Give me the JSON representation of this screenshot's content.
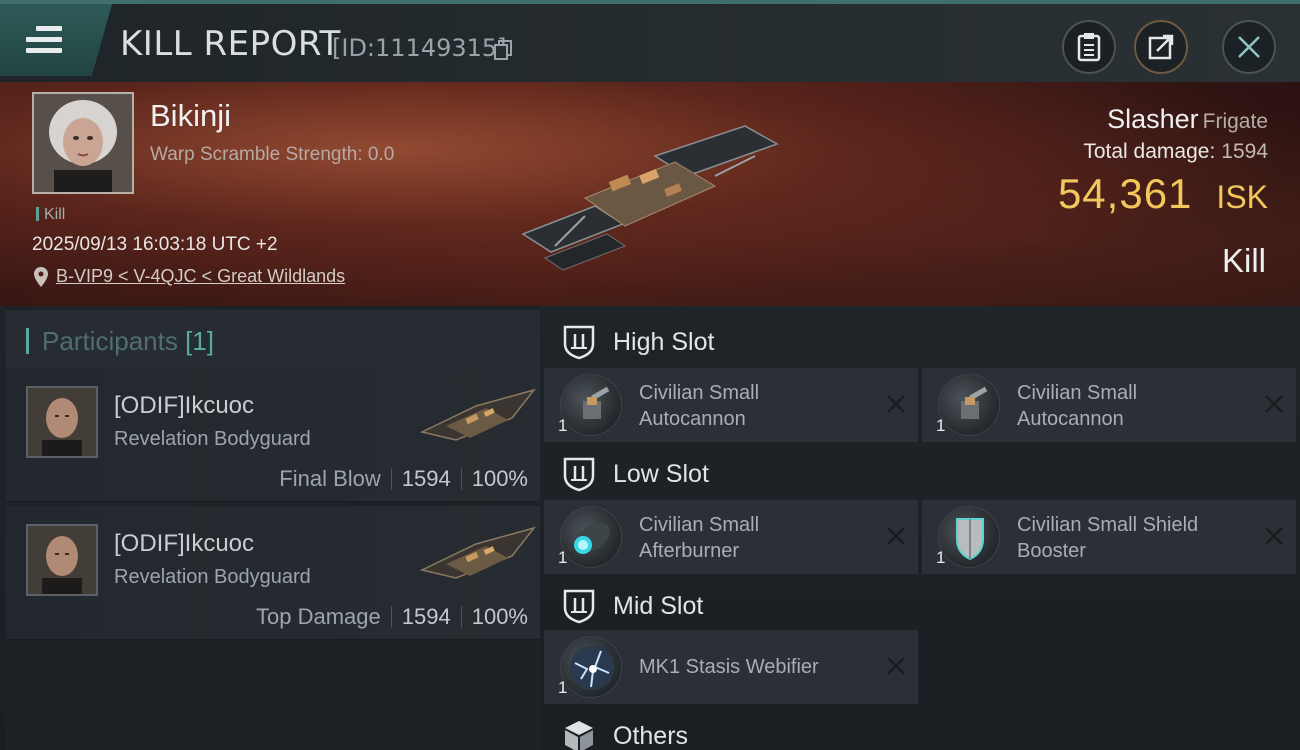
{
  "header": {
    "title": "KILL REPORT",
    "report_id": "[ID:11149315]",
    "icons": [
      "menu-icon",
      "copy-icon",
      "clipboard-icon",
      "share-icon",
      "close-icon"
    ]
  },
  "victim": {
    "name": "Bikinji",
    "scramble": "Warp Scramble Strength: 0.0",
    "tag": "Kill",
    "datetime": "2025/09/13 16:03:18 UTC +2",
    "location": "B-VIP9 < V-4QJC < Great Wildlands",
    "ship_name": "Slasher",
    "ship_class": "Frigate",
    "damage_label": "Total damage:",
    "damage_value": "1594",
    "isk_value": "54,361",
    "isk_unit": "ISK",
    "result": "Kill"
  },
  "participants": {
    "label": "Participants",
    "count": "[1]",
    "items": [
      {
        "name": "[ODIF]Ikcuoc",
        "ship": "Revelation Bodyguard",
        "role": "Final Blow",
        "damage": "1594",
        "percent": "100%"
      },
      {
        "name": "[ODIF]Ikcuoc",
        "ship": "Revelation Bodyguard",
        "role": "Top Damage",
        "damage": "1594",
        "percent": "100%"
      }
    ]
  },
  "slots": {
    "high": {
      "label": "High Slot",
      "modules": [
        {
          "name": "Civilian Small Autocannon",
          "line1": "Civilian Small",
          "line2": "Autocannon",
          "qty": "1",
          "icon": "autocannon-icon"
        },
        {
          "name": "Civilian Small Autocannon",
          "line1": "Civilian Small",
          "line2": "Autocannon",
          "qty": "1",
          "icon": "autocannon-icon"
        }
      ]
    },
    "low": {
      "label": "Low Slot",
      "modules": [
        {
          "name": "Civilian Small Afterburner",
          "line1": "Civilian Small",
          "line2": "Afterburner",
          "qty": "1",
          "icon": "afterburner-icon"
        },
        {
          "name": "Civilian Small Shield Booster",
          "line1": "Civilian Small Shield",
          "line2": "Booster",
          "qty": "1",
          "icon": "shield-booster-icon"
        }
      ]
    },
    "mid": {
      "label": "Mid Slot",
      "modules": [
        {
          "name": "MK1 Stasis Webifier",
          "qty": "1",
          "icon": "stasis-webifier-icon"
        }
      ]
    },
    "others": {
      "label": "Others"
    }
  },
  "colors": {
    "accent_teal": "#58a9a2",
    "isk_gold": "#f2c75c",
    "banner_red": "#5a2219"
  }
}
